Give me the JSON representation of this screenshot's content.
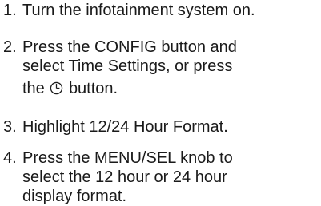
{
  "steps": [
    {
      "number": "1.",
      "lines": [
        "Turn the infotainment system on."
      ]
    },
    {
      "number": "2.",
      "lines": [
        "Press the CONFIG button and",
        "select Time Settings, or press"
      ],
      "last_line_before_icon": "the",
      "icon": "clock-icon",
      "last_line_after_icon": "button."
    },
    {
      "number": "3.",
      "lines": [
        "Highlight 12/24 Hour Format."
      ]
    },
    {
      "number": "4.",
      "lines": [
        "Press the MENU/SEL knob to",
        "select the 12 hour or 24 hour",
        "display format."
      ]
    }
  ]
}
